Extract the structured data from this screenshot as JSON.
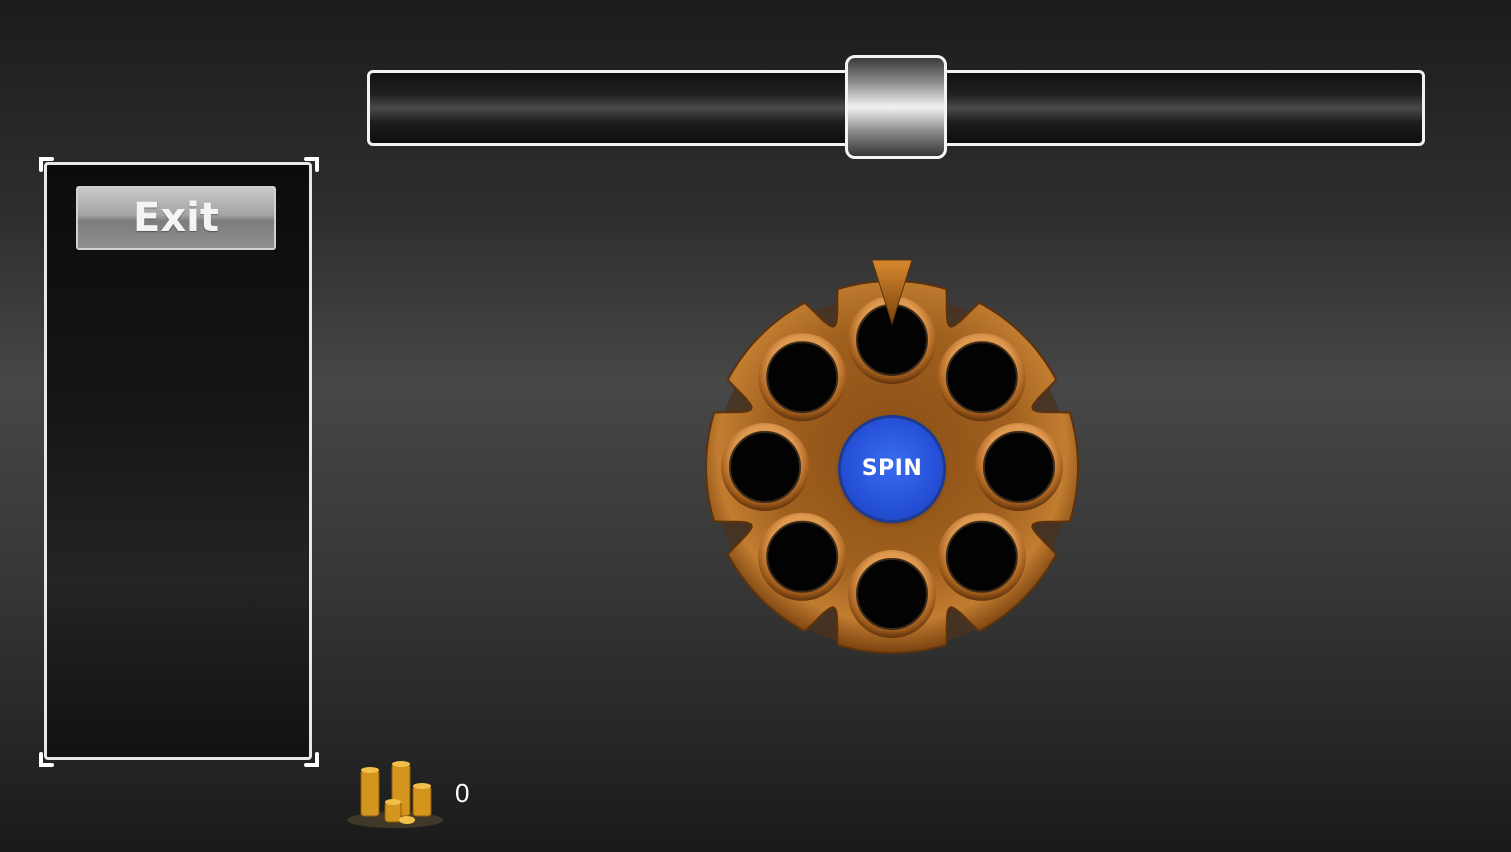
{
  "exit_label": "Exit",
  "spin_label": "SPIN",
  "coins": {
    "count": "0",
    "icon": "coin-stack-icon"
  },
  "slider": {
    "value": 0.5
  },
  "cylinder": {
    "chambers": 8
  },
  "colors": {
    "panel_border": "#e8e8e8",
    "spin_blue": "#2550d8",
    "cylinder_brass": "#b8742a"
  }
}
